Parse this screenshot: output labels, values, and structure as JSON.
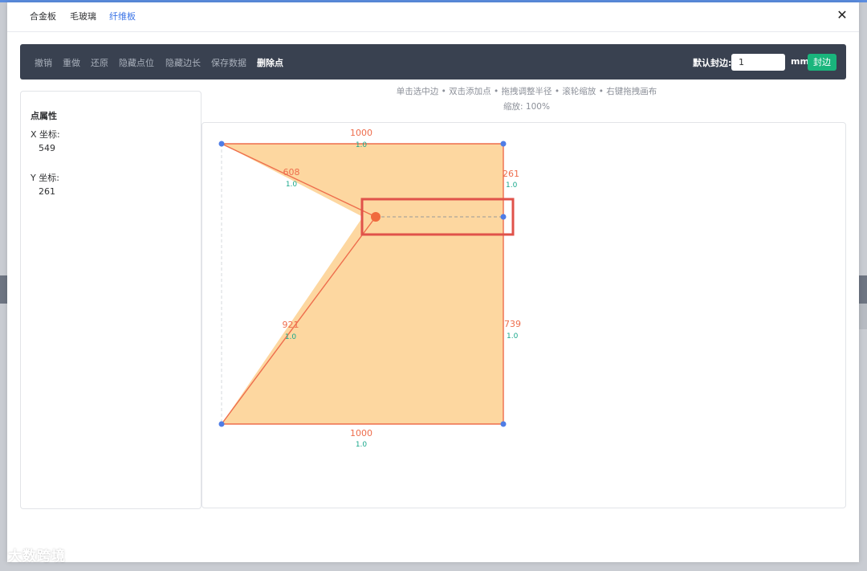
{
  "tabs": [
    {
      "label": "合金板",
      "active": false
    },
    {
      "label": "毛玻璃",
      "active": false
    },
    {
      "label": "纤维板",
      "active": true
    }
  ],
  "close_icon": "close-icon",
  "toolbar": {
    "buttons": [
      "撤销",
      "重做",
      "还原",
      "隐藏点位",
      "隐藏边长",
      "保存数据",
      "删除点"
    ],
    "seal_label": "默认封边:",
    "seal_value": "1",
    "unit": "mm",
    "seal_button": "封边"
  },
  "props": {
    "title": "点属性",
    "x_label": "X 坐标:",
    "x_value": "549",
    "y_label": "Y 坐标:",
    "y_value": "261"
  },
  "hint": "单击选中边 • 双击添加点 • 拖拽调整半径 • 滚轮缩放 • 右键拖拽画布",
  "zoom_text": "缩放: 100%",
  "colors": {
    "toolbar_bg": "#394150",
    "accent": "#3a73e6",
    "seal_button": "#19b57c",
    "shape_fill": "#fdd7a0",
    "edge": "#ee6d4c",
    "edge_value": "#19a88c",
    "highlight": "#e0524a"
  },
  "edges": [
    {
      "length": "1000",
      "seal": "1.0"
    },
    {
      "length": "261",
      "seal": "1.0"
    },
    {
      "length": "739",
      "seal": "1.0"
    },
    {
      "length": "1000",
      "seal": "1.0"
    },
    {
      "length": "921",
      "seal": "1.0"
    },
    {
      "length": "608",
      "seal": "1.0"
    }
  ],
  "watermark": "大数跨境"
}
